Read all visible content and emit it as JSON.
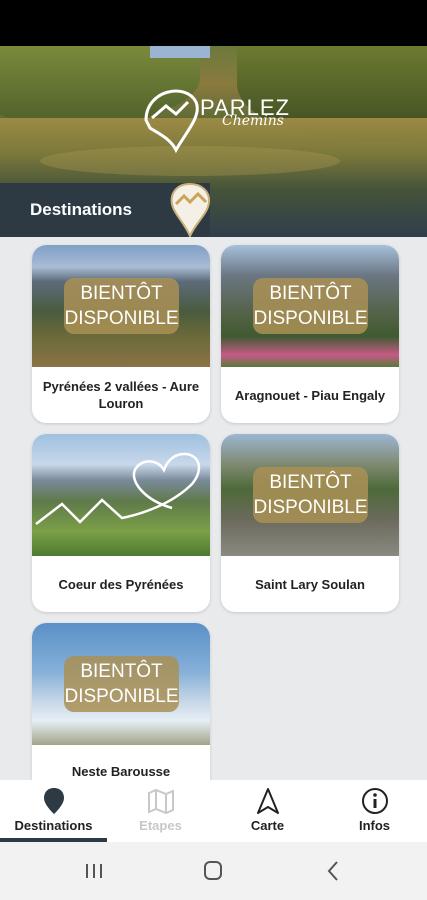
{
  "header": {
    "logo_title": "PARLEZ",
    "logo_subtitle": "Chemins",
    "section_title": "Destinations"
  },
  "badge_text_line1": "BIENTÔT",
  "badge_text_line2": "DISPONIBLE",
  "destinations": [
    {
      "label": "Pyrénées 2 vallées - Aure Louron",
      "coming_soon": true
    },
    {
      "label": "Aragnouet - Piau Engaly",
      "coming_soon": true
    },
    {
      "label": "Coeur des Pyrénées",
      "coming_soon": false
    },
    {
      "label": "Saint Lary Soulan",
      "coming_soon": true
    },
    {
      "label": "Neste Barousse",
      "coming_soon": true
    }
  ],
  "bottom_nav": [
    {
      "label": "Destinations",
      "icon": "map-pin-icon",
      "active": true,
      "enabled": true
    },
    {
      "label": "Etapes",
      "icon": "map-icon",
      "active": false,
      "enabled": false
    },
    {
      "label": "Carte",
      "icon": "navigation-arrow-icon",
      "active": false,
      "enabled": true
    },
    {
      "label": "Infos",
      "icon": "info-icon",
      "active": false,
      "enabled": true
    }
  ],
  "colors": {
    "primary": "#2d3a43",
    "badge": "#aa9155",
    "background": "#e9eaec"
  }
}
